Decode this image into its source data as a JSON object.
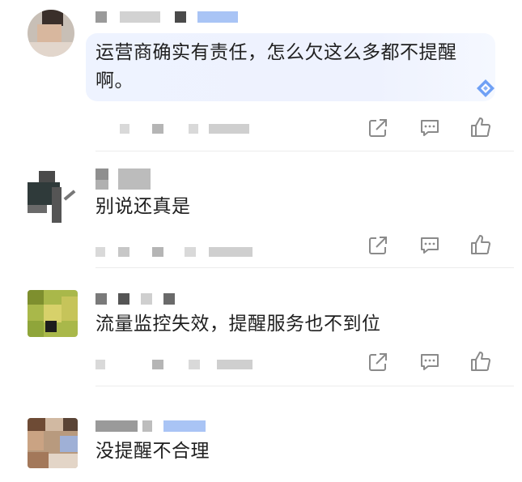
{
  "comments": [
    {
      "text": "运营商确实有责任，怎么欠这么多都不提醒啊。"
    },
    {
      "text": "别说还真是"
    },
    {
      "text": "流量监控失效，提醒服务也不到位"
    },
    {
      "text": "没提醒不合理"
    }
  ],
  "actions": {
    "share_icon": "share-square-arrow",
    "reply_icon": "comment-bubble",
    "like_icon": "thumbs-up"
  },
  "colors": {
    "highlight_bubble": "#eef2fe",
    "icon_gray": "#8a8a8a",
    "badge_blue": "#a9c4f5"
  }
}
